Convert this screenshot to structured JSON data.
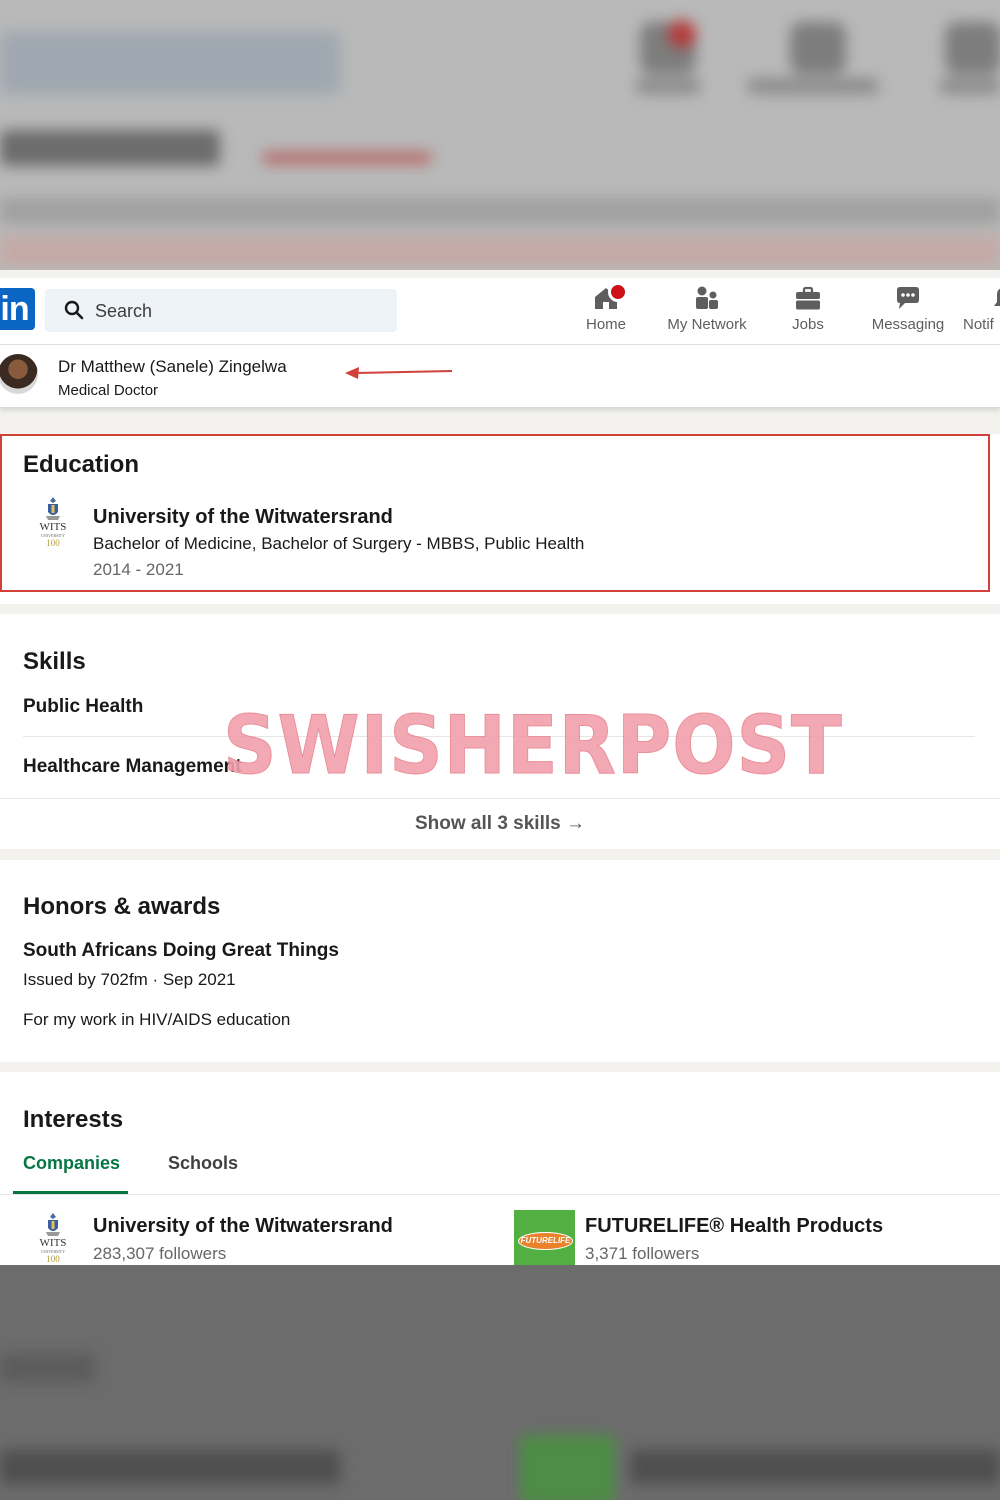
{
  "nav": {
    "search_placeholder": "Search",
    "items": [
      {
        "label": "Home",
        "icon": "home-icon",
        "has_badge": true
      },
      {
        "label": "My Network",
        "icon": "network-icon"
      },
      {
        "label": "Jobs",
        "icon": "briefcase-icon"
      },
      {
        "label": "Messaging",
        "icon": "chat-icon"
      },
      {
        "label": "Notif",
        "icon": "bell-icon"
      }
    ],
    "accent": "#0a66c2",
    "badge_color": "#cc1016"
  },
  "profile": {
    "name": "Dr Matthew (Sanele) Zingelwa",
    "headline": "Medical Doctor"
  },
  "education": {
    "heading": "Education",
    "school": "University of the Witwatersrand",
    "degree": "Bachelor of Medicine, Bachelor of Surgery - MBBS, Public Health",
    "years": "2014 - 2021",
    "highlight_color": "#d2403a"
  },
  "skills": {
    "heading": "Skills",
    "items": [
      "Public Health",
      "Healthcare Management"
    ],
    "show_all": "Show all 3 skills →"
  },
  "honors": {
    "heading": "Honors & awards",
    "title": "South Africans Doing Great Things",
    "issued": "Issued by 702fm · Sep 2021",
    "description": "For my work in HIV/AIDS education"
  },
  "interests": {
    "heading": "Interests",
    "tabs": [
      "Companies",
      "Schools"
    ],
    "active_tab_color": "#057642",
    "entities": [
      {
        "name": "University of the Witwatersrand",
        "followers": "283,307 followers",
        "logo": "wits-logo"
      },
      {
        "name": "FUTURELIFE® Health Products",
        "followers": "3,371 followers",
        "logo": "futurelife-logo"
      }
    ]
  },
  "logos": {
    "wits_text": "WITS",
    "wits_sub": "UNIVERSITY",
    "wits_100": "100",
    "futurelife_text": "FUTURELIFE"
  },
  "watermark": "SWISHERPOST"
}
